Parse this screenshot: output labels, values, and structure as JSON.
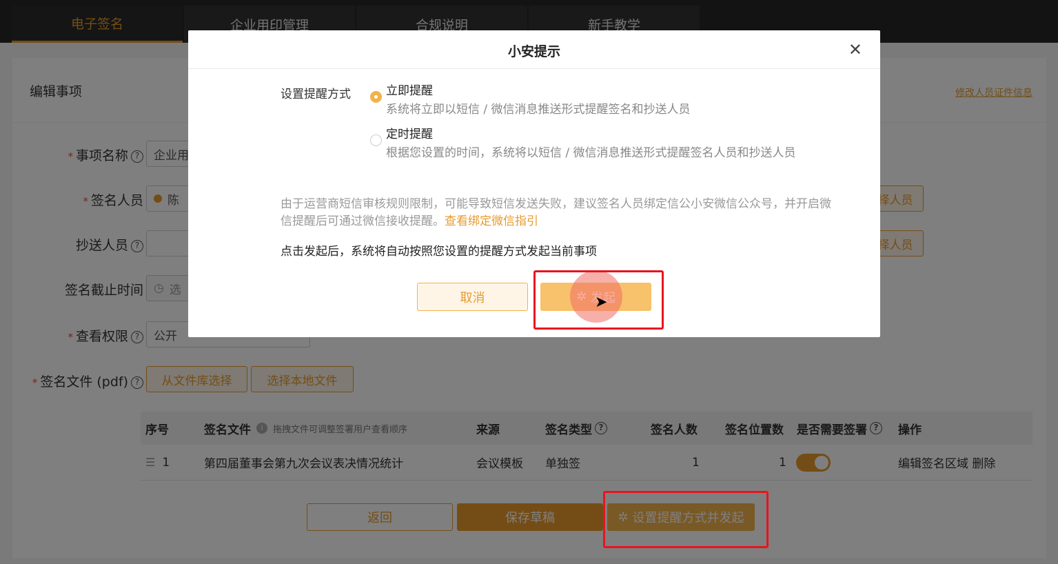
{
  "nav": {
    "tabs": [
      {
        "label": "电子签名"
      },
      {
        "label": "企业用印管理"
      },
      {
        "label": "合规说明"
      },
      {
        "label": "新手教学"
      }
    ]
  },
  "page": {
    "title": "编辑事项",
    "edit_cert_link": "修改人员证件信息",
    "fields": {
      "item_name": {
        "label": "事项名称",
        "value": "企业用"
      },
      "signers": {
        "label": "签名人员",
        "value": "陈",
        "select_btn": "择人员"
      },
      "cc": {
        "label": "抄送人员",
        "value": "",
        "select_btn": "择人员"
      },
      "deadline": {
        "label": "签名截止时间",
        "placeholder": "选"
      },
      "permission": {
        "label": "查看权限",
        "value": "公开"
      },
      "file": {
        "label": "签名文件 (pdf)",
        "from_library": "从文件库选择",
        "from_local": "选择本地文件"
      }
    },
    "table": {
      "headers": {
        "index": "序号",
        "file": "签名文件",
        "file_note": "拖拽文件可调整签署用户查看顺序",
        "source": "来源",
        "type": "签名类型",
        "signers": "签名人数",
        "positions": "签名位置数",
        "seal": "是否需要签署",
        "actions": "操作"
      },
      "rows": [
        {
          "index": "1",
          "file": "第四届董事会第九次会议表决情况统计",
          "source": "会议模板",
          "type": "单独签",
          "signers": "1",
          "positions": "1",
          "seal_on": true,
          "actions": "编辑签名区域 删除"
        }
      ]
    },
    "buttons": {
      "back": "返回",
      "save_draft": "保存草稿",
      "set_and_send": "设置提醒方式并发起"
    }
  },
  "modal": {
    "title": "小安提示",
    "reminder_label": "设置提醒方式",
    "options": [
      {
        "title": "立即提醒",
        "desc": "系统将立即以短信 / 微信消息推送形式提醒签名和抄送人员",
        "checked": true
      },
      {
        "title": "定时提醒",
        "desc": "根据您设置的时间，系统将以短信 / 微信消息推送形式提醒签名人员和抄送人员",
        "checked": false
      }
    ],
    "notice": "由于运营商短信审核规则限制，可能导致短信发送失败，建议签名人员绑定信公小安微信公众号，并开启微信提醒后可通过微信接收提醒。",
    "notice_link": "查看绑定微信指引",
    "info": "点击发起后，系统将自动按照您设置的提醒方式发起当前事项",
    "cancel": "取消",
    "submit": "发起"
  },
  "colors": {
    "accent": "#e89a2c",
    "annotation_red": "#e8141e"
  }
}
